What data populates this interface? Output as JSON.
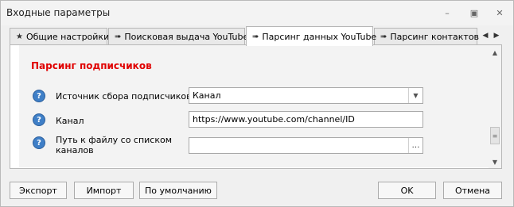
{
  "window": {
    "title": "Входные параметры",
    "controls": {
      "minimize": "–",
      "restore": "▣",
      "close": "✕"
    }
  },
  "tabs": [
    {
      "icon": "★",
      "label": "Общие настройки",
      "active": false
    },
    {
      "icon": "➠",
      "label": "Поисковая выдача YouTube",
      "active": false
    },
    {
      "icon": "➠",
      "label": "Парсинг данных YouTube",
      "active": true
    },
    {
      "icon": "➠",
      "label": "Парсинг контактов",
      "active": false
    }
  ],
  "tabnav": {
    "prev": "◀",
    "next": "▶"
  },
  "section": {
    "title": "Парсинг подписчиков"
  },
  "fields": [
    {
      "label": "Источник сбора подписчиков",
      "value": "Канал",
      "type": "dropdown",
      "help": "?"
    },
    {
      "label": "Канал",
      "value": "https://www.youtube.com/channel/ID",
      "type": "text",
      "help": "?"
    },
    {
      "label": "Путь к файлу со списком каналов",
      "value": "",
      "type": "file",
      "help": "?"
    }
  ],
  "field_glyphs": {
    "dropdown": "▼",
    "browse": "…"
  },
  "scrollbar": {
    "up": "▲",
    "down": "▼",
    "grip": "≡"
  },
  "buttons": {
    "export": "Экспорт",
    "import": "Импорт",
    "defaults": "По умолчанию",
    "ok": "OK",
    "cancel": "Отмена"
  }
}
